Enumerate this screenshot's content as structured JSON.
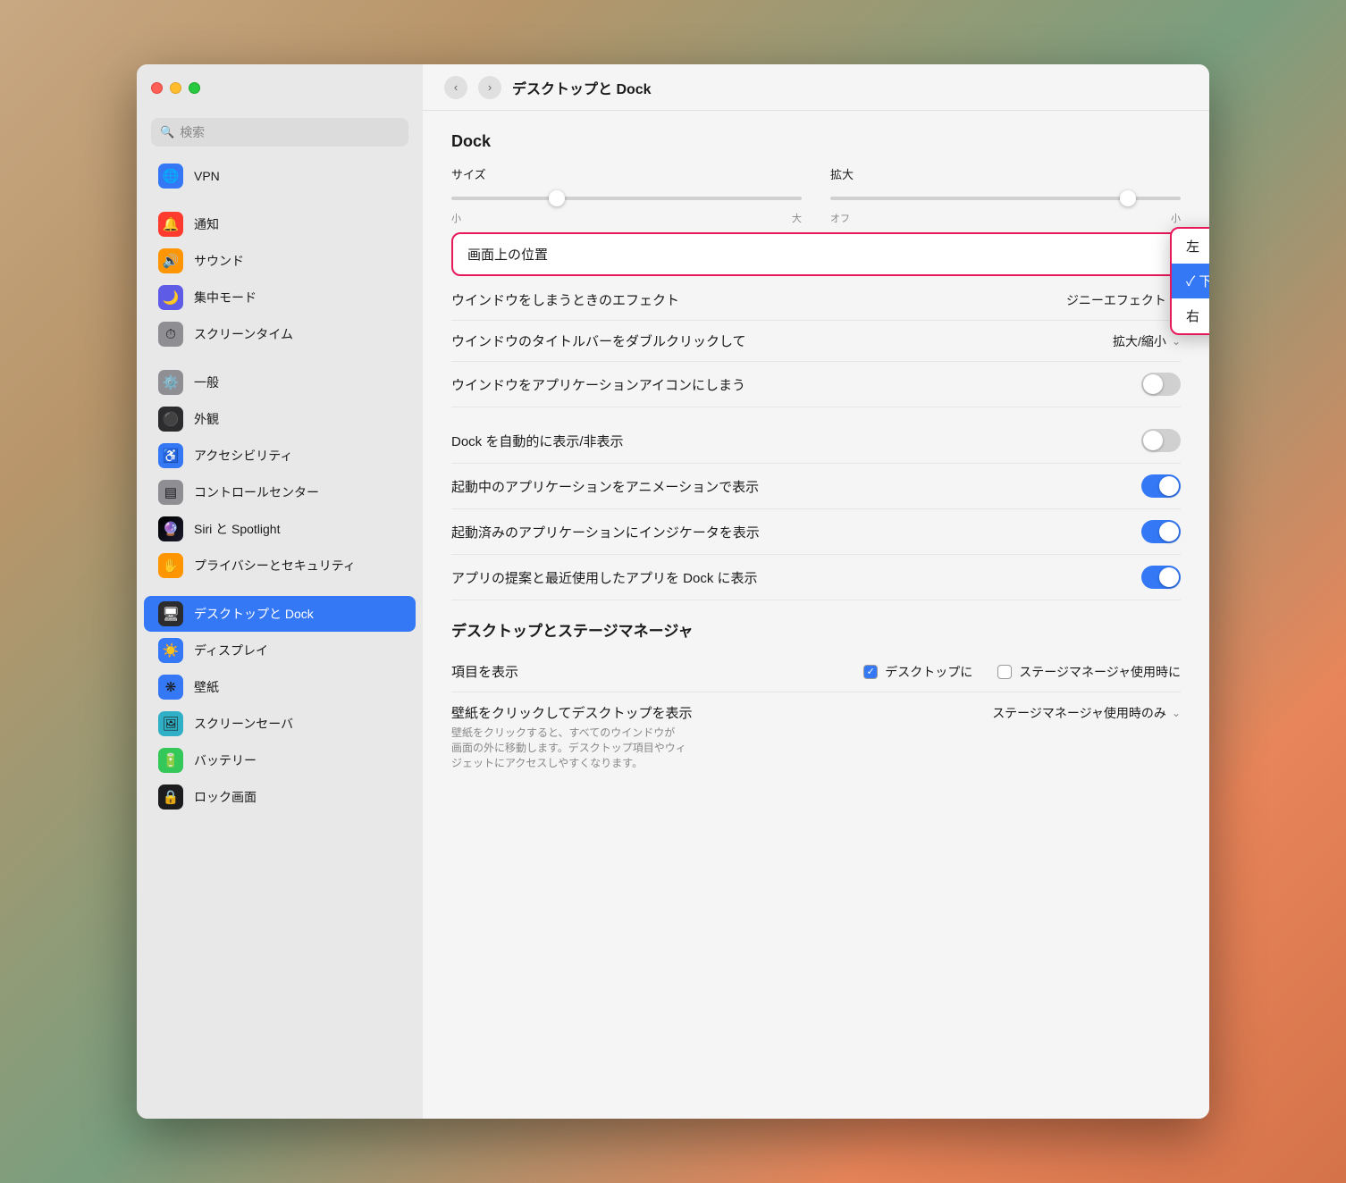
{
  "window": {
    "title": "デスクトップと Dock"
  },
  "sidebar": {
    "search_placeholder": "検索",
    "items": [
      {
        "id": "vpn",
        "label": "VPN",
        "icon": "🌐",
        "bg": "bg-blue",
        "active": false
      },
      {
        "id": "notifications",
        "label": "通知",
        "icon": "🔔",
        "bg": "bg-red",
        "active": false
      },
      {
        "id": "sound",
        "label": "サウンド",
        "icon": "🔊",
        "bg": "bg-orange",
        "active": false
      },
      {
        "id": "focus",
        "label": "集中モード",
        "icon": "🌙",
        "bg": "bg-purple",
        "active": false
      },
      {
        "id": "screentime",
        "label": "スクリーンタイム",
        "icon": "⏱",
        "bg": "bg-gray",
        "active": false
      },
      {
        "id": "general",
        "label": "一般",
        "icon": "⚙️",
        "bg": "bg-gray",
        "active": false
      },
      {
        "id": "appearance",
        "label": "外観",
        "icon": "⚫",
        "bg": "bg-dark",
        "active": false
      },
      {
        "id": "accessibility",
        "label": "アクセシビリティ",
        "icon": "♿",
        "bg": "bg-blue",
        "active": false
      },
      {
        "id": "controlcenter",
        "label": "コントロールセンター",
        "icon": "▤",
        "bg": "bg-gray",
        "active": false
      },
      {
        "id": "siri",
        "label": "Siri と Spotlight",
        "icon": "🔮",
        "bg": "bg-siri",
        "active": false
      },
      {
        "id": "privacy",
        "label": "プライバシーとセキュリティ",
        "icon": "✋",
        "bg": "bg-orange",
        "active": false
      },
      {
        "id": "desktop",
        "label": "デスクトップと Dock",
        "icon": "🖥",
        "bg": "bg-dark",
        "active": true
      },
      {
        "id": "display",
        "label": "ディスプレイ",
        "icon": "☀️",
        "bg": "bg-blue",
        "active": false
      },
      {
        "id": "wallpaper",
        "label": "壁紙",
        "icon": "❋",
        "bg": "bg-blue",
        "active": false
      },
      {
        "id": "screensaver",
        "label": "スクリーンセーバ",
        "icon": "🖼",
        "bg": "bg-teal",
        "active": false
      },
      {
        "id": "battery",
        "label": "バッテリー",
        "icon": "🔋",
        "bg": "bg-green",
        "active": false
      },
      {
        "id": "lockscreen",
        "label": "ロック画面",
        "icon": "🔒",
        "bg": "bg-black",
        "active": false
      }
    ]
  },
  "main": {
    "back_label": "‹",
    "forward_label": "›",
    "title": "デスクトップと Dock",
    "dock_section": "Dock",
    "size_label": "サイズ",
    "size_min": "小",
    "size_max": "大",
    "size_value": 30,
    "enlarge_label": "拡大",
    "enlarge_off": "オフ",
    "enlarge_min": "小",
    "enlarge_value": 85,
    "position_label": "画面上の位置",
    "position_options": [
      "左",
      "下",
      "右"
    ],
    "position_selected": "下",
    "window_effect_label": "ウインドウをしまうときのエフェクト",
    "window_effect_value": "ジニーエフェクト",
    "titlebar_click_label": "ウインドウのタイトルバーをダブルクリックして",
    "titlebar_click_value": "拡大/縮小",
    "minimize_to_app_label": "ウインドウをアプリケーションアイコンにしまう",
    "minimize_to_app_value": false,
    "auto_hide_label": "Dock を自動的に表示/非表示",
    "auto_hide_value": false,
    "animate_launch_label": "起動中のアプリケーションをアニメーションで表示",
    "animate_launch_value": true,
    "show_indicator_label": "起動済みのアプリケーションにインジケータを表示",
    "show_indicator_value": true,
    "show_recent_label": "アプリの提案と最近使用したアプリを Dock に表示",
    "show_recent_value": true,
    "desktop_section": "デスクトップとステージマネージャ",
    "show_items_label": "項目を表示",
    "desktop_option": "デスクトップに",
    "stage_manager_option": "ステージマネージャ使用時に",
    "desktop_checked": true,
    "stage_checked": false,
    "click_wallpaper_label": "壁紙をクリックしてデスクトップを表示",
    "click_wallpaper_value": "ステージマネージャ使用時のみ",
    "click_wallpaper_note": "壁紙をクリックすると、すべてのウインドウが\n画面の外に移動します。デスクトップ項目やウィ\nジェットにアクセスしやすくなります。"
  }
}
